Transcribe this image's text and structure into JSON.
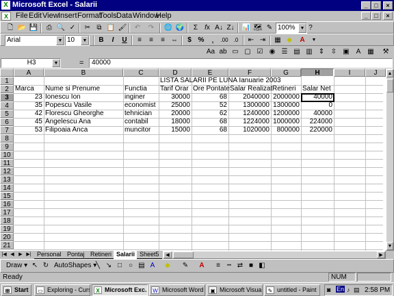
{
  "window": {
    "title": "Microsoft Excel - Salarii",
    "min": "_",
    "max": "□",
    "close": "×",
    "doc_min": "_",
    "doc_max": "□",
    "doc_close": "×"
  },
  "menu": [
    "File",
    "Edit",
    "View",
    "Insert",
    "Format",
    "Tools",
    "Data",
    "Window",
    "Help"
  ],
  "toolbar": {
    "zoom": "100%",
    "font": "Arial",
    "size": "10"
  },
  "formula": {
    "namebox": "H3",
    "equals": "=",
    "value": "40000"
  },
  "columns": [
    "A",
    "B",
    "C",
    "D",
    "E",
    "F",
    "G",
    "H",
    "I",
    "J"
  ],
  "rows": [
    "1",
    "2",
    "3",
    "4",
    "5",
    "6",
    "7",
    "8",
    "9",
    "10",
    "11",
    "12",
    "13",
    "14",
    "15",
    "16",
    "17",
    "18",
    "19",
    "20",
    "21"
  ],
  "sheet": {
    "title": "LISTA SALARII PE LUNA Ianuarie 2003",
    "headers": [
      "Marca",
      "Nume si Prenume",
      "Functia",
      "Tarif Orar",
      "Ore Pontate",
      "Salar Realizat",
      "Retineri",
      "Salar Net"
    ],
    "data": [
      [
        "23",
        "Ionescu Ion",
        "inginer",
        "30000",
        "68",
        "2040000",
        "2000000",
        "40000"
      ],
      [
        "35",
        "Popescu Vasile",
        "economist",
        "25000",
        "52",
        "1300000",
        "1300000",
        "0"
      ],
      [
        "42",
        "Florescu Gheorghe",
        "tehnician",
        "20000",
        "62",
        "1240000",
        "1200000",
        "40000"
      ],
      [
        "45",
        "Angelescu Ana",
        "contabil",
        "18000",
        "68",
        "1224000",
        "1000000",
        "224000"
      ],
      [
        "53",
        "Filipoaia Anca",
        "muncitor",
        "15000",
        "68",
        "1020000",
        "800000",
        "220000"
      ]
    ]
  },
  "tabs": [
    "Personal",
    "Pontaj",
    "Retineri",
    "Salarii",
    "Sheet5"
  ],
  "draw": {
    "draw_label": "Draw",
    "autoshapes_label": "AutoShapes"
  },
  "status": {
    "text": "Ready",
    "num": "NUM"
  },
  "taskbar": {
    "start": "Start",
    "tasks": [
      "Exploring - CursL...",
      "Microsoft Exc...",
      "Microsoft Word -...",
      "Microsoft Visual ...",
      "untitled - Paint"
    ],
    "lang": "En",
    "time": "2:58 PM"
  }
}
